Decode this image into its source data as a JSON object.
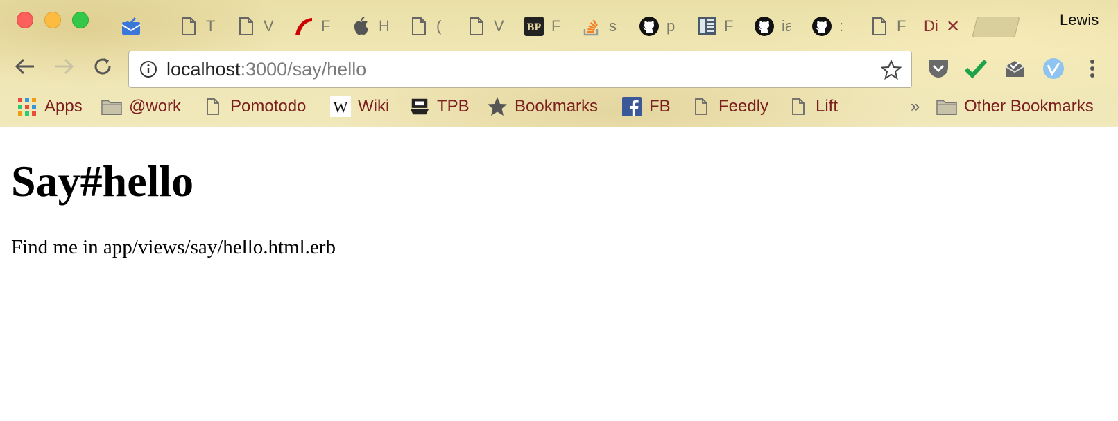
{
  "window": {
    "profile_name": "Lewis"
  },
  "tabs": [
    {
      "icon": "inbox-icon",
      "title": ""
    },
    {
      "icon": "page-icon",
      "title": "T"
    },
    {
      "icon": "page-icon",
      "title": "V"
    },
    {
      "icon": "rails-icon",
      "title": "F"
    },
    {
      "icon": "apple-icon",
      "title": "H"
    },
    {
      "icon": "page-icon",
      "title": "("
    },
    {
      "icon": "page-icon",
      "title": "V"
    },
    {
      "icon": "bp-icon",
      "title": "F"
    },
    {
      "icon": "stackoverflow-icon",
      "title": "s"
    },
    {
      "icon": "github-icon",
      "title": "p"
    },
    {
      "icon": "book-icon",
      "title": "F"
    },
    {
      "icon": "github-icon",
      "title": "ia"
    },
    {
      "icon": "github-icon",
      "title": ":"
    },
    {
      "icon": "page-icon",
      "title": "F"
    },
    {
      "icon": "",
      "title": "Di",
      "active": true
    }
  ],
  "toolbar": {
    "url_host": "localhost",
    "url_path": ":3000/say/hello"
  },
  "bookmarks": {
    "items": [
      {
        "label": "Apps",
        "icon": "apps-grid-icon"
      },
      {
        "label": "@work",
        "icon": "folder-icon"
      },
      {
        "label": "Pomotodo",
        "icon": "page-icon"
      },
      {
        "label": "Wiki",
        "icon": "wikipedia-icon"
      },
      {
        "label": "TPB",
        "icon": "pirate-ship-icon"
      },
      {
        "label": "Bookmarks",
        "icon": "star-icon"
      },
      {
        "label": "FB",
        "icon": "facebook-icon"
      },
      {
        "label": "Feedly",
        "icon": "page-icon"
      },
      {
        "label": "Lift",
        "icon": "page-icon"
      }
    ],
    "overflow_label": "»",
    "other_label": "Other Bookmarks"
  },
  "page": {
    "title": "Say#hello",
    "paragraph": "Find me in app/views/say/hello.html.erb"
  },
  "colors": {
    "bookmark_text": "#7a1e1e",
    "chrome_bg": "#efe6b4"
  }
}
